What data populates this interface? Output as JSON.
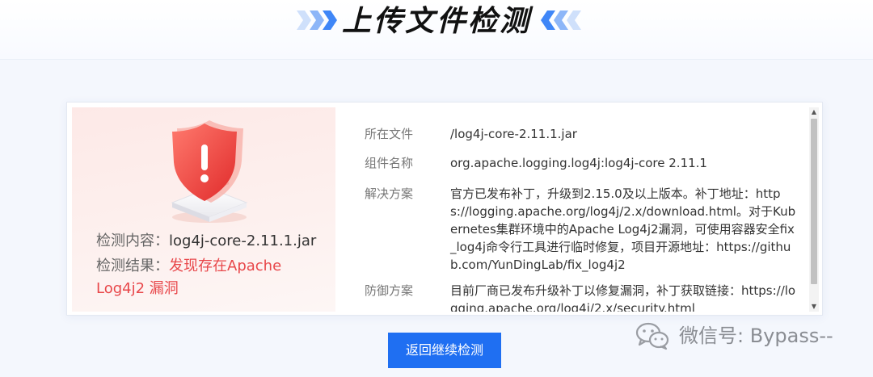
{
  "header": {
    "title": "上传文件检测"
  },
  "summary": {
    "content_label": "检测内容：",
    "content_value": "log4j-core-2.11.1.jar",
    "result_label": "检测结果：",
    "result_value_line1": "发现存在Apache",
    "result_value_line2": "Log4j2 漏洞"
  },
  "details": [
    {
      "label": "所在文件",
      "value": "/log4j-core-2.11.1.jar"
    },
    {
      "label": "组件名称",
      "value": "org.apache.logging.log4j:log4j-core 2.11.1"
    },
    {
      "label": "解决方案",
      "value": "官方已发布补丁，升级到2.15.0及以上版本。补丁地址：https://logging.apache.org/log4j/2.x/download.html。对于Kubernetes集群环境中的Apache Log4j2漏洞，可使用容器安全fix_log4j命令行工具进行临时修复，项目开源地址：https://github.com/YunDingLab/fix_log4j2"
    },
    {
      "label": "防御方案",
      "value": "目前厂商已发布升级补丁以修复漏洞，补丁获取链接：https://logging.apache.org/log4j/2.x/security.html"
    }
  ],
  "actions": {
    "back_button": "返回继续检测"
  },
  "watermark": {
    "text": "微信号: Bypass--"
  },
  "colors": {
    "accent": "#1f6ff2",
    "danger": "#e8474a",
    "chevron": "#3f86f7"
  },
  "icons": {
    "title_left": "double-chevron-right-icon",
    "title_right": "double-chevron-left-icon",
    "alert": "warning-shield-icon",
    "watermark": "wechat-icon"
  }
}
